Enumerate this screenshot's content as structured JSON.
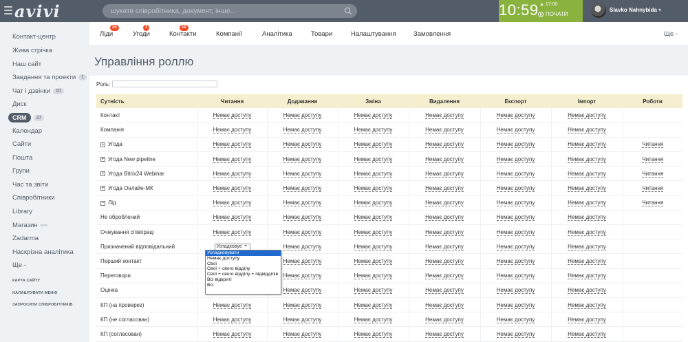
{
  "topbar": {
    "logo": "avivi",
    "search_placeholder": "шукати співробітника, документ, інше...",
    "clock_time": "10:59",
    "clock_alarm": "17:00",
    "clock_action": "ПОЧАТИ",
    "user_name": "Slavko Nahnybida",
    "accent_color": "#89b33e"
  },
  "sidebar": {
    "items": [
      {
        "label": "Контакт-центр"
      },
      {
        "label": "Жива стрічка"
      },
      {
        "label": "Наш сайт"
      },
      {
        "label": "Завдання та проекти",
        "count": "1"
      },
      {
        "label": "Чат і дзвінки",
        "count": "10"
      },
      {
        "label": "Диск"
      },
      {
        "label": "CRM",
        "count": "37",
        "active": true
      },
      {
        "label": "Календар"
      },
      {
        "label": "Сайти"
      },
      {
        "label": "Пошта"
      },
      {
        "label": "Групи"
      },
      {
        "label": "Час та звіти"
      },
      {
        "label": "Співробітники"
      },
      {
        "label": "Library"
      },
      {
        "label": "Магазин",
        "sup": "beta"
      },
      {
        "label": "Zadarma"
      },
      {
        "label": "Наскрізна аналітика"
      },
      {
        "label": "Ще -"
      }
    ],
    "links": [
      "КАРТА САЙТУ",
      "НАЛАШТУВАТИ МЕНЮ",
      "ЗАПРОСИТИ СПІВРОБІТНИКІВ"
    ]
  },
  "tabs": {
    "items": [
      {
        "label": "Ліди",
        "badge": "26"
      },
      {
        "label": "Угоди",
        "badge": "1"
      },
      {
        "label": "Контакти",
        "badge": "10"
      },
      {
        "label": "Компанії"
      },
      {
        "label": "Аналітика"
      },
      {
        "label": "Товари"
      },
      {
        "label": "Налаштування"
      },
      {
        "label": "Замовлення"
      }
    ],
    "more": "Ще -"
  },
  "page": {
    "title": "Управління роллю",
    "role_label": "Роль:",
    "role_value": ""
  },
  "table": {
    "headers": [
      "Сутність",
      "Читання",
      "Додавання",
      "Зміна",
      "Видалення",
      "Експорт",
      "Імпорт",
      "Роботи"
    ],
    "rows": [
      {
        "name": "Контакт",
        "cells": [
          "Немає доступу",
          "Немає доступу",
          "Немає доступу",
          "Немає доступу",
          "Немає доступу",
          "Немає доступу",
          ""
        ]
      },
      {
        "name": "Компанія",
        "cells": [
          "Немає доступу",
          "Немає доступу",
          "Немає доступу",
          "Немає доступу",
          "Немає доступу",
          "Немає доступу",
          ""
        ]
      },
      {
        "name": "Угода",
        "expand": true,
        "cells": [
          "Немає доступу",
          "Немає доступу",
          "Немає доступу",
          "Немає доступу",
          "Немає доступу",
          "Немає доступу",
          "Читання"
        ]
      },
      {
        "name": "Угода New pipeline",
        "expand": true,
        "cells": [
          "Немає доступу",
          "Немає доступу",
          "Немає доступу",
          "Немає доступу",
          "Немає доступу",
          "Немає доступу",
          "Читання"
        ]
      },
      {
        "name": "Угода Bitrix24 Webinar",
        "expand": true,
        "cells": [
          "Немає доступу",
          "Немає доступу",
          "Немає доступу",
          "Немає доступу",
          "Немає доступу",
          "Немає доступу",
          "Читання"
        ]
      },
      {
        "name": "Угода Онлайн-МК",
        "expand": true,
        "cells": [
          "Немає доступу",
          "Немає доступу",
          "Немає доступу",
          "Немає доступу",
          "Немає доступу",
          "Немає доступу",
          "Читання"
        ]
      },
      {
        "name": "Лід",
        "expand": true,
        "expanded": true,
        "cells": [
          "Немає доступу",
          "Немає доступу",
          "Немає доступу",
          "Немає доступу",
          "Немає доступу",
          "Немає доступу",
          "Читання"
        ]
      },
      {
        "name": "Не оброблений",
        "sub": true,
        "cells": [
          "Немає доступу",
          "Немає доступу",
          "Немає доступу",
          "Немає доступу",
          "Немає доступу",
          "Немає доступу",
          ""
        ]
      },
      {
        "name": "Очікування співпраці",
        "sub": true,
        "cells": [
          "Немає доступу",
          "Немає доступу",
          "Немає доступу",
          "Немає доступу",
          "Немає доступу",
          "Немає доступу",
          ""
        ]
      },
      {
        "name": "Призначений відповідальний",
        "sub": true,
        "select": "Успадковуе",
        "cells": [
          "",
          "Немає доступу",
          "Немає доступу",
          "Немає доступу",
          "Немає доступу",
          "Немає доступу",
          ""
        ]
      },
      {
        "name": "Перший контакт",
        "sub": true,
        "cells": [
          "",
          "Немає доступу",
          "Немає доступу",
          "Немає доступу",
          "Немає доступу",
          "Немає доступу",
          ""
        ]
      },
      {
        "name": "Переговори",
        "sub": true,
        "cells": [
          "",
          "Немає доступу",
          "Немає доступу",
          "Немає доступу",
          "Немає доступу",
          "Немає доступу",
          ""
        ]
      },
      {
        "name": "Оцінка",
        "sub": true,
        "cells": [
          "",
          "Немає доступу",
          "Немає доступу",
          "Немає доступу",
          "Немає доступу",
          "Немає доступу",
          ""
        ]
      },
      {
        "name": "КП (на проверке)",
        "sub": true,
        "cells": [
          "Немає доступу",
          "Немає доступу",
          "Немає доступу",
          "Немає доступу",
          "Немає доступу",
          "Немає доступу",
          ""
        ]
      },
      {
        "name": "КП (не согласован)",
        "sub": true,
        "cells": [
          "Немає доступу",
          "Немає доступу",
          "Немає доступу",
          "Немає доступу",
          "Немає доступу",
          "Немає доступу",
          ""
        ]
      },
      {
        "name": "КП (согласован)",
        "sub": true,
        "cells": [
          "Немає доступу",
          "Немає доступу",
          "Немає доступу",
          "Немає доступу",
          "Немає доступу",
          "Немає доступу",
          ""
        ]
      }
    ]
  },
  "dropdown": {
    "options": [
      "Успадковувати",
      "Немає доступу",
      "Свої",
      "Свої + свого відділу",
      "Свої + свого відділу + підвідділів",
      "Всі відкриті",
      "Всі"
    ],
    "selected_index": 0
  }
}
